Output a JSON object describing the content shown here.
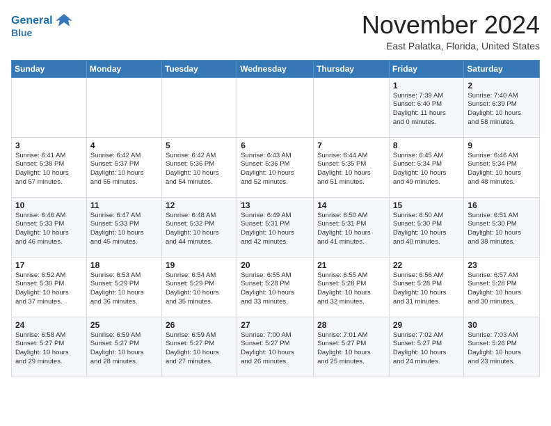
{
  "header": {
    "logo_line1": "General",
    "logo_line2": "Blue",
    "month": "November 2024",
    "location": "East Palatka, Florida, United States"
  },
  "weekdays": [
    "Sunday",
    "Monday",
    "Tuesday",
    "Wednesday",
    "Thursday",
    "Friday",
    "Saturday"
  ],
  "weeks": [
    [
      {
        "day": "",
        "info": ""
      },
      {
        "day": "",
        "info": ""
      },
      {
        "day": "",
        "info": ""
      },
      {
        "day": "",
        "info": ""
      },
      {
        "day": "",
        "info": ""
      },
      {
        "day": "1",
        "info": "Sunrise: 7:39 AM\nSunset: 6:40 PM\nDaylight: 11 hours\nand 0 minutes."
      },
      {
        "day": "2",
        "info": "Sunrise: 7:40 AM\nSunset: 6:39 PM\nDaylight: 10 hours\nand 58 minutes."
      }
    ],
    [
      {
        "day": "3",
        "info": "Sunrise: 6:41 AM\nSunset: 5:38 PM\nDaylight: 10 hours\nand 57 minutes."
      },
      {
        "day": "4",
        "info": "Sunrise: 6:42 AM\nSunset: 5:37 PM\nDaylight: 10 hours\nand 55 minutes."
      },
      {
        "day": "5",
        "info": "Sunrise: 6:42 AM\nSunset: 5:36 PM\nDaylight: 10 hours\nand 54 minutes."
      },
      {
        "day": "6",
        "info": "Sunrise: 6:43 AM\nSunset: 5:36 PM\nDaylight: 10 hours\nand 52 minutes."
      },
      {
        "day": "7",
        "info": "Sunrise: 6:44 AM\nSunset: 5:35 PM\nDaylight: 10 hours\nand 51 minutes."
      },
      {
        "day": "8",
        "info": "Sunrise: 6:45 AM\nSunset: 5:34 PM\nDaylight: 10 hours\nand 49 minutes."
      },
      {
        "day": "9",
        "info": "Sunrise: 6:46 AM\nSunset: 5:34 PM\nDaylight: 10 hours\nand 48 minutes."
      }
    ],
    [
      {
        "day": "10",
        "info": "Sunrise: 6:46 AM\nSunset: 5:33 PM\nDaylight: 10 hours\nand 46 minutes."
      },
      {
        "day": "11",
        "info": "Sunrise: 6:47 AM\nSunset: 5:33 PM\nDaylight: 10 hours\nand 45 minutes."
      },
      {
        "day": "12",
        "info": "Sunrise: 6:48 AM\nSunset: 5:32 PM\nDaylight: 10 hours\nand 44 minutes."
      },
      {
        "day": "13",
        "info": "Sunrise: 6:49 AM\nSunset: 5:31 PM\nDaylight: 10 hours\nand 42 minutes."
      },
      {
        "day": "14",
        "info": "Sunrise: 6:50 AM\nSunset: 5:31 PM\nDaylight: 10 hours\nand 41 minutes."
      },
      {
        "day": "15",
        "info": "Sunrise: 6:50 AM\nSunset: 5:30 PM\nDaylight: 10 hours\nand 40 minutes."
      },
      {
        "day": "16",
        "info": "Sunrise: 6:51 AM\nSunset: 5:30 PM\nDaylight: 10 hours\nand 38 minutes."
      }
    ],
    [
      {
        "day": "17",
        "info": "Sunrise: 6:52 AM\nSunset: 5:30 PM\nDaylight: 10 hours\nand 37 minutes."
      },
      {
        "day": "18",
        "info": "Sunrise: 6:53 AM\nSunset: 5:29 PM\nDaylight: 10 hours\nand 36 minutes."
      },
      {
        "day": "19",
        "info": "Sunrise: 6:54 AM\nSunset: 5:29 PM\nDaylight: 10 hours\nand 35 minutes."
      },
      {
        "day": "20",
        "info": "Sunrise: 6:55 AM\nSunset: 5:28 PM\nDaylight: 10 hours\nand 33 minutes."
      },
      {
        "day": "21",
        "info": "Sunrise: 6:55 AM\nSunset: 5:28 PM\nDaylight: 10 hours\nand 32 minutes."
      },
      {
        "day": "22",
        "info": "Sunrise: 6:56 AM\nSunset: 5:28 PM\nDaylight: 10 hours\nand 31 minutes."
      },
      {
        "day": "23",
        "info": "Sunrise: 6:57 AM\nSunset: 5:28 PM\nDaylight: 10 hours\nand 30 minutes."
      }
    ],
    [
      {
        "day": "24",
        "info": "Sunrise: 6:58 AM\nSunset: 5:27 PM\nDaylight: 10 hours\nand 29 minutes."
      },
      {
        "day": "25",
        "info": "Sunrise: 6:59 AM\nSunset: 5:27 PM\nDaylight: 10 hours\nand 28 minutes."
      },
      {
        "day": "26",
        "info": "Sunrise: 6:59 AM\nSunset: 5:27 PM\nDaylight: 10 hours\nand 27 minutes."
      },
      {
        "day": "27",
        "info": "Sunrise: 7:00 AM\nSunset: 5:27 PM\nDaylight: 10 hours\nand 26 minutes."
      },
      {
        "day": "28",
        "info": "Sunrise: 7:01 AM\nSunset: 5:27 PM\nDaylight: 10 hours\nand 25 minutes."
      },
      {
        "day": "29",
        "info": "Sunrise: 7:02 AM\nSunset: 5:27 PM\nDaylight: 10 hours\nand 24 minutes."
      },
      {
        "day": "30",
        "info": "Sunrise: 7:03 AM\nSunset: 5:26 PM\nDaylight: 10 hours\nand 23 minutes."
      }
    ]
  ]
}
